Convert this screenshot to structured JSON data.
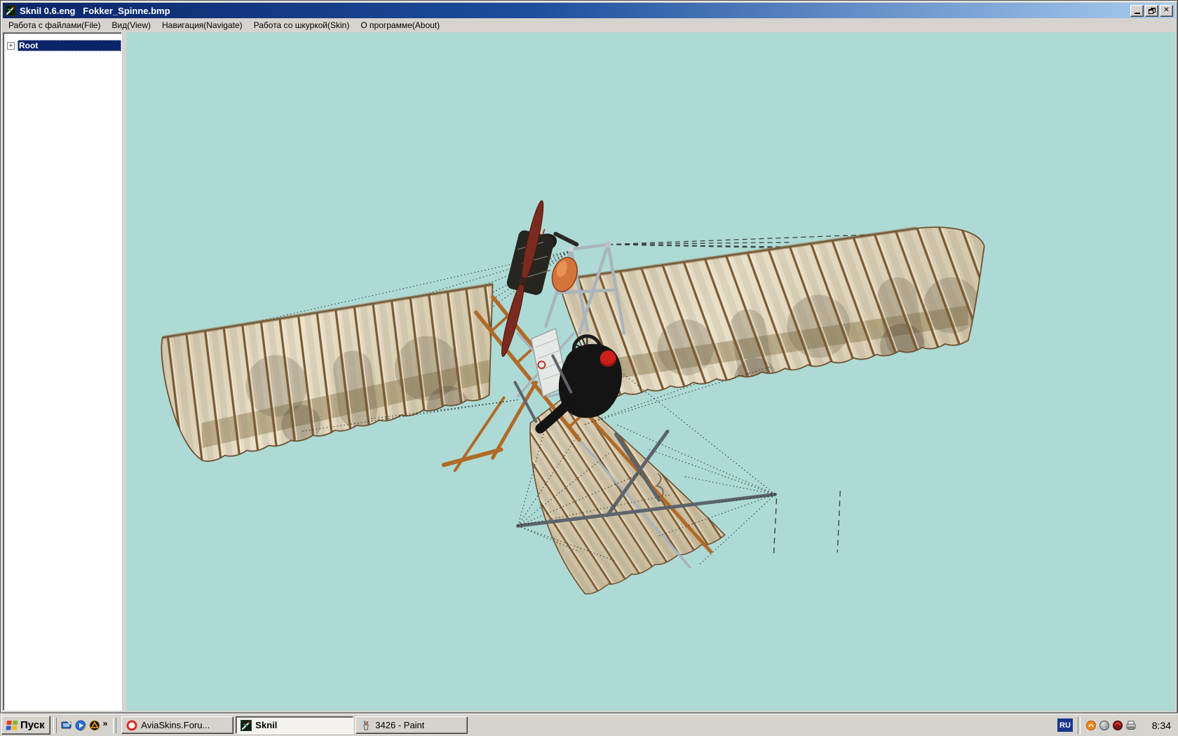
{
  "window": {
    "title": "Sknil 0.6.eng   Fokker_Spinne.bmp",
    "icon": "sknil-app-icon",
    "controls": {
      "close_glyph": "✕"
    }
  },
  "menu": {
    "items": [
      {
        "label": "Работа с файлами(File)"
      },
      {
        "label": "Вид(View)"
      },
      {
        "label": "Навигация(Navigate)"
      },
      {
        "label": "Работа со шкуркой(Skin)"
      },
      {
        "label": "О программе(About)"
      }
    ]
  },
  "sidebar": {
    "tree": {
      "expand_glyph": "+",
      "root_label": "Root"
    }
  },
  "viewport": {
    "description": "3D view of Fokker Spinne monoplane skin (ribbed tan wings with ghosted lettering, wire-braced frame, pilot with red helmet, fan tail)"
  },
  "taskbar": {
    "start_label": "Пуск",
    "overflow_glyph": "»",
    "quick_launch": [
      {
        "name": "show-desktop"
      },
      {
        "name": "media-player"
      },
      {
        "name": "amber-triangle-app"
      }
    ],
    "tasks": [
      {
        "label": "AviaSkins.Foru...",
        "icon": "opera",
        "active": false
      },
      {
        "label": "Sknil",
        "icon": "sknil",
        "active": true
      },
      {
        "label": "3426 - Paint",
        "icon": "paint",
        "active": false
      }
    ],
    "tray": {
      "language": "RU",
      "clock": "8:34",
      "icons": [
        {
          "name": "antivirus-orange"
        },
        {
          "name": "volume-sphere"
        },
        {
          "name": "red-round-app"
        },
        {
          "name": "printer"
        }
      ]
    }
  },
  "theme": {
    "chrome": "#d6d3ce",
    "titlebar_left": "#0b2569",
    "titlebar_mid": "#1c4e9c",
    "titlebar_right": "#a8ccf0",
    "selection": "#0a246a",
    "viewport_bg": "#aedad5",
    "tray_lang_bg": "#19368c",
    "fabric_light": "#e9e0ca",
    "fabric_dark": "#cfc3a8",
    "rib": "#7a5a33",
    "band": "#8d7c50",
    "ghost": "#675a47",
    "propeller": "#7a2a1e",
    "engine": "#26251f",
    "tank": "#d4743a",
    "frame": "#a9b4bd",
    "wood": "#b06a28",
    "pilot": "#141414",
    "helmet": "#cf1f1c",
    "wire": "#1c1c1c",
    "tail_tube": "#5c646b"
  }
}
